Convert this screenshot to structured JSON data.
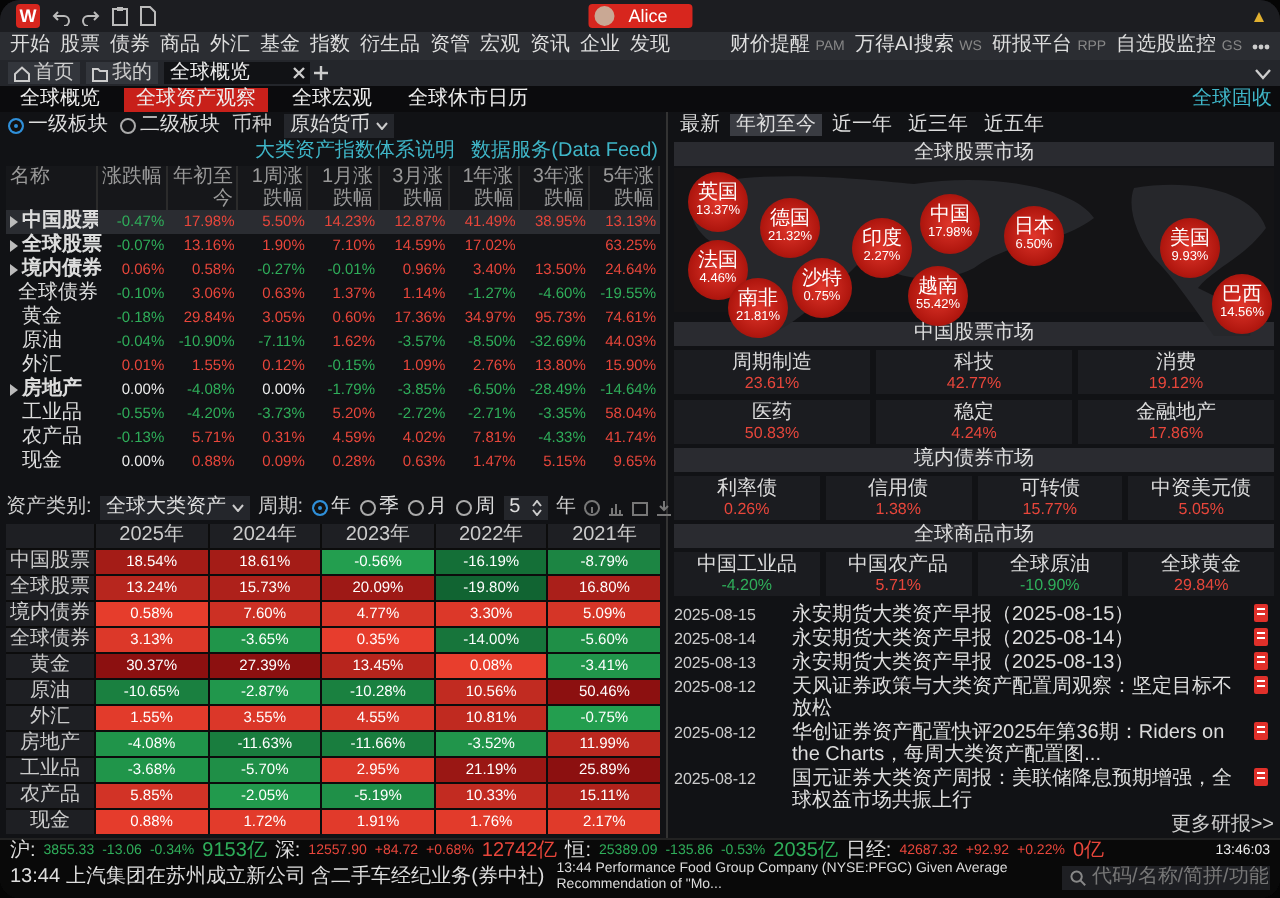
{
  "titlebar": {
    "logo": "W",
    "user": "Alice"
  },
  "menu": {
    "items": [
      "开始",
      "股票",
      "债券",
      "商品",
      "外汇",
      "基金",
      "指数",
      "衍生品",
      "资管",
      "宏观",
      "资讯",
      "企业",
      "发现"
    ],
    "tools": [
      {
        "label": "财价提醒",
        "code": "PAM"
      },
      {
        "label": "万得AI搜索",
        "code": "WS"
      },
      {
        "label": "研报平台",
        "code": "RPP"
      },
      {
        "label": "自选股监控",
        "code": "GS"
      }
    ]
  },
  "tabs": [
    {
      "label": "首页",
      "kind": "home",
      "selected": false
    },
    {
      "label": "我的",
      "kind": "mine",
      "selected": false
    },
    {
      "label": "全球概览",
      "kind": "page",
      "selected": true
    }
  ],
  "subtabs": [
    {
      "label": "全球概览",
      "selected": false
    },
    {
      "label": "全球资产观察",
      "selected": true
    },
    {
      "label": "全球宏观",
      "selected": false
    },
    {
      "label": "全球休市日历",
      "selected": false
    }
  ],
  "subtab_link": "全球固收",
  "overview": {
    "modes": [
      {
        "label": "一级板块",
        "selected": true
      },
      {
        "label": "二级板块",
        "selected": false
      }
    ],
    "currency_label": "币种",
    "currency": "原始货币",
    "links": [
      "大类资产指数体系说明",
      "数据服务(Data Feed)"
    ],
    "columns": [
      "名称",
      "涨跌幅",
      "年初至今",
      "1周涨跌幅",
      "1月涨跌幅",
      "3月涨跌幅",
      "1年涨跌幅",
      "3年涨跌幅",
      "5年涨跌幅"
    ],
    "rows": [
      {
        "name": "中国股票",
        "expandable": true,
        "selected": true,
        "values": [
          "-0.47%",
          "17.98%",
          "5.50%",
          "14.23%",
          "12.87%",
          "41.49%",
          "38.95%",
          "13.13%"
        ]
      },
      {
        "name": "全球股票",
        "expandable": true,
        "selected": false,
        "values": [
          "-0.07%",
          "13.16%",
          "1.90%",
          "7.10%",
          "14.59%",
          "17.02%"
        ],
        "values_after_gap": [
          "63.25%"
        ]
      },
      {
        "name": "境内债券",
        "expandable": true,
        "selected": false,
        "values": [
          "0.06%",
          "0.58%",
          "-0.27%",
          "-0.01%",
          "0.96%",
          "3.40%",
          "13.50%",
          "24.64%"
        ]
      },
      {
        "name": "全球债券",
        "expandable": false,
        "selected": false,
        "values": [
          "-0.10%",
          "3.06%",
          "0.63%",
          "1.37%",
          "1.14%",
          "-1.27%",
          "-4.60%",
          "-19.55%"
        ]
      },
      {
        "name": "黄金",
        "expandable": false,
        "selected": false,
        "values": [
          "-0.18%",
          "29.84%",
          "3.05%",
          "0.60%",
          "17.36%",
          "34.97%",
          "95.73%",
          "74.61%"
        ]
      },
      {
        "name": "原油",
        "expandable": false,
        "selected": false,
        "values": [
          "-0.04%",
          "-10.90%",
          "-7.11%",
          "1.62%",
          "-3.57%",
          "-8.50%",
          "-32.69%",
          "44.03%"
        ]
      },
      {
        "name": "外汇",
        "expandable": false,
        "selected": false,
        "values": [
          "0.01%",
          "1.55%",
          "0.12%",
          "-0.15%",
          "1.09%",
          "2.76%",
          "13.80%",
          "15.90%"
        ]
      },
      {
        "name": "房地产",
        "expandable": true,
        "selected": false,
        "values": [
          "0.00%",
          "-4.08%",
          "0.00%",
          "-1.79%",
          "-3.85%",
          "-6.50%",
          "-28.49%",
          "-14.64%"
        ]
      },
      {
        "name": "工业品",
        "expandable": false,
        "selected": false,
        "values": [
          "-0.55%",
          "-4.20%",
          "-3.73%",
          "5.20%",
          "-2.72%",
          "-2.71%",
          "-3.35%",
          "58.04%"
        ]
      },
      {
        "name": "农产品",
        "expandable": false,
        "selected": false,
        "values": [
          "-0.13%",
          "5.71%",
          "0.31%",
          "4.59%",
          "4.02%",
          "7.81%",
          "-4.33%",
          "41.74%"
        ]
      },
      {
        "name": "现金",
        "expandable": false,
        "selected": false,
        "values": [
          "0.00%",
          "0.88%",
          "0.09%",
          "0.28%",
          "0.63%",
          "1.47%",
          "5.15%",
          "9.65%"
        ]
      }
    ]
  },
  "heatmap": {
    "category_label": "资产类别:",
    "category": "全球大类资产",
    "period_label": "周期:",
    "periods": [
      {
        "label": "年",
        "selected": true
      },
      {
        "label": "季",
        "selected": false
      },
      {
        "label": "月",
        "selected": false
      },
      {
        "label": "周",
        "selected": false
      }
    ],
    "count": "5",
    "unit": "年",
    "columns": [
      "2025年",
      "2024年",
      "2023年",
      "2022年",
      "2021年"
    ],
    "rows": [
      {
        "name": "中国股票",
        "values": [
          "18.54%",
          "18.61%",
          "-0.56%",
          "-16.19%",
          "-8.79%"
        ]
      },
      {
        "name": "全球股票",
        "values": [
          "13.24%",
          "15.73%",
          "20.09%",
          "-19.80%",
          "16.80%"
        ]
      },
      {
        "name": "境内债券",
        "values": [
          "0.58%",
          "7.60%",
          "4.77%",
          "3.30%",
          "5.09%"
        ]
      },
      {
        "name": "全球债券",
        "values": [
          "3.13%",
          "-3.65%",
          "0.35%",
          "-14.00%",
          "-5.60%"
        ]
      },
      {
        "name": "黄金",
        "values": [
          "30.37%",
          "27.39%",
          "13.45%",
          "0.08%",
          "-3.41%"
        ]
      },
      {
        "name": "原油",
        "values": [
          "-10.65%",
          "-2.87%",
          "-10.28%",
          "10.56%",
          "50.46%"
        ]
      },
      {
        "name": "外汇",
        "values": [
          "1.55%",
          "3.55%",
          "4.55%",
          "10.81%",
          "-0.75%"
        ]
      },
      {
        "name": "房地产",
        "values": [
          "-4.08%",
          "-11.63%",
          "-11.66%",
          "-3.52%",
          "11.99%"
        ]
      },
      {
        "name": "工业品",
        "values": [
          "-3.68%",
          "-5.70%",
          "2.95%",
          "21.19%",
          "25.89%"
        ]
      },
      {
        "name": "农产品",
        "values": [
          "5.85%",
          "-2.05%",
          "-5.19%",
          "10.33%",
          "15.11%"
        ]
      },
      {
        "name": "现金",
        "values": [
          "0.88%",
          "1.72%",
          "1.91%",
          "1.76%",
          "2.17%"
        ]
      }
    ]
  },
  "markets": {
    "tabs": [
      {
        "label": "最新",
        "selected": false
      },
      {
        "label": "年初至今",
        "selected": true
      },
      {
        "label": "近一年",
        "selected": false
      },
      {
        "label": "近三年",
        "selected": false
      },
      {
        "label": "近五年",
        "selected": false
      }
    ],
    "sections": [
      {
        "title": "全球股票市场",
        "kind": "map",
        "items": [
          {
            "name": "英国",
            "value": "13.37%"
          },
          {
            "name": "法国",
            "value": "4.46%"
          },
          {
            "name": "南非",
            "value": "21.81%"
          },
          {
            "name": "德国",
            "value": "21.32%"
          },
          {
            "name": "沙特",
            "value": "0.75%"
          },
          {
            "name": "印度",
            "value": "2.27%"
          },
          {
            "name": "中国",
            "value": "17.98%"
          },
          {
            "name": "越南",
            "value": "55.42%"
          },
          {
            "name": "日本",
            "value": "6.50%"
          },
          {
            "name": "美国",
            "value": "9.93%"
          },
          {
            "name": "巴西",
            "value": "14.56%"
          }
        ]
      },
      {
        "title": "中国股票市场",
        "kind": "grid",
        "items": [
          {
            "name": "周期制造",
            "value": "23.61%"
          },
          {
            "name": "科技",
            "value": "42.77%"
          },
          {
            "name": "消费",
            "value": "19.12%"
          },
          {
            "name": "医药",
            "value": "50.83%"
          },
          {
            "name": "稳定",
            "value": "4.24%"
          },
          {
            "name": "金融地产",
            "value": "17.86%"
          }
        ]
      },
      {
        "title": "境内债券市场",
        "kind": "row",
        "items": [
          {
            "name": "利率债",
            "value": "0.26%"
          },
          {
            "name": "信用债",
            "value": "1.38%"
          },
          {
            "name": "可转债",
            "value": "15.77%"
          },
          {
            "name": "中资美元债",
            "value": "5.05%"
          }
        ]
      },
      {
        "title": "全球商品市场",
        "kind": "row",
        "items": [
          {
            "name": "中国工业品",
            "value": "-4.20%"
          },
          {
            "name": "中国农产品",
            "value": "5.71%"
          },
          {
            "name": "全球原油",
            "value": "-10.90%"
          },
          {
            "name": "全球黄金",
            "value": "29.84%"
          }
        ]
      }
    ]
  },
  "reports": {
    "items": [
      {
        "date": "2025-08-15",
        "title": "永安期货大类资产早报（2025-08-15）"
      },
      {
        "date": "2025-08-14",
        "title": "永安期货大类资产早报（2025-08-14）"
      },
      {
        "date": "2025-08-13",
        "title": "永安期货大类资产早报（2025-08-13）"
      },
      {
        "date": "2025-08-12",
        "title": "天风证券政策与大类资产配置周观察：坚定目标不放松"
      },
      {
        "date": "2025-08-12",
        "title": "华创证券资产配置快评2025年第36期：Riders on the Charts，每周大类资产配置图..."
      },
      {
        "date": "2025-08-12",
        "title": "国元证券大类资产周报：美联储降息预期增强，全球权益市场共振上行"
      }
    ],
    "more": "更多研报>>"
  },
  "status_bar": {
    "quotes": [
      {
        "label": "沪:",
        "values": [
          "3855.33",
          "-13.06",
          "-0.34%",
          "9153亿"
        ]
      },
      {
        "label": "深:",
        "values": [
          "12557.90",
          "+84.72",
          "+0.68%",
          "12742亿"
        ]
      },
      {
        "label": "恒:",
        "values": [
          "25389.09",
          "-135.86",
          "-0.53%",
          "2035亿"
        ]
      },
      {
        "label": "日经:",
        "values": [
          "42687.32",
          "+92.92",
          "+0.22%",
          "0亿"
        ]
      }
    ],
    "time": "13:46:03"
  },
  "ticker": [
    "13:44 上汽集团在苏州成立新公司 含二手车经纪业务(券中社)",
    "13:44 Performance Food Group Company (NYSE:PFGC) Given Average Recommendation of \"Mo..."
  ],
  "search": {
    "placeholder": "代码/名称/简拼/功能"
  }
}
